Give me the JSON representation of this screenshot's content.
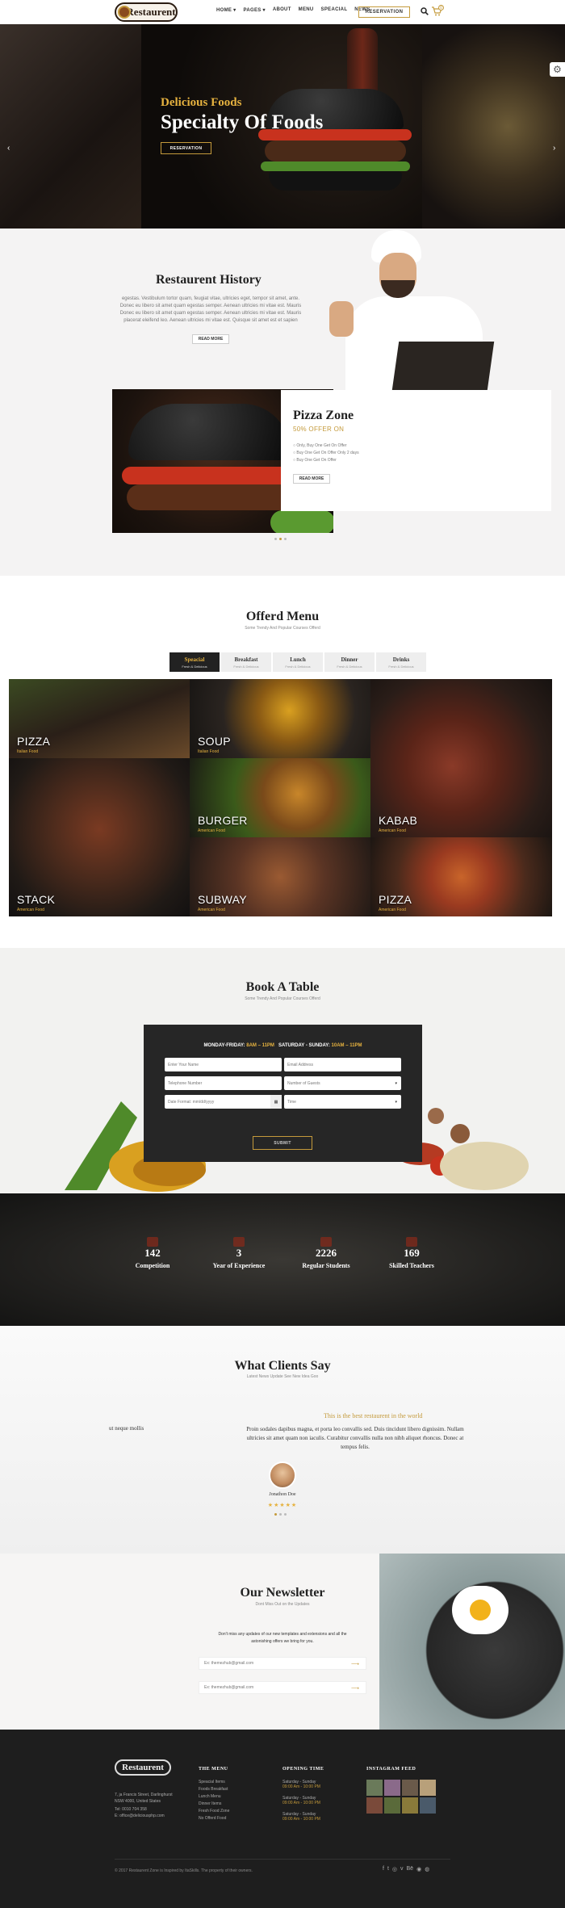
{
  "header": {
    "logo_text": "Restaurent",
    "nav": [
      "HOME ▾",
      "PAGES ▾",
      "ABOUT",
      "MENU",
      "SPEACIAL",
      "NEWS"
    ],
    "reservation_label": "RESERVATION",
    "cart_count": "0"
  },
  "hero": {
    "subtitle": "Delicious Foods",
    "title": "Specialty Of Foods",
    "button_label": "RESERVATION"
  },
  "history": {
    "title": "Restaurent History",
    "text": "egestas. Vestibulum tortor quam, feugiat vitae, ultricies eget, tempor sit amet, ante. Donec eu libero sit amet quam egestas semper. Aenean ultricies mi vitae est. Mauris Donec eu libero sit amet quam egestas semper. Aenean ultricies mi vitae est. Mauris placerat eleifend leo. Aenean ultricies mi vitae est. Quisque sit amet est et sapien ullamcorper pharetra. Vestibulum erat wisi, condimentum sed, commodo vitae, ornare sit amet, wisi. tristique senectus et et malesuada placerat leo.",
    "button_label": "READ MORE",
    "card": {
      "title": "Pizza Zone",
      "offer": "50% OFFER ON",
      "items": [
        "Only, Buy One Get On Offer",
        "Buy One Get On Offer Only 2 days",
        "Buy One Get On Offer"
      ],
      "button_label": "READ MORE"
    }
  },
  "menu": {
    "title": "Offerd Menu",
    "subtitle": "Some Trendy And Popular Courses Offerd",
    "tabs": [
      {
        "label": "Speacial",
        "sub": "Fresh & Delicious"
      },
      {
        "label": "Breakfast",
        "sub": "Fresh & Delicious"
      },
      {
        "label": "Lunch",
        "sub": "Fresh & Delicious"
      },
      {
        "label": "Dinner",
        "sub": "Fresh & Delicious"
      },
      {
        "label": "Drinks",
        "sub": "Fresh & Delicious"
      }
    ],
    "items": [
      {
        "name": "PIZZA",
        "sub": "Italian Food"
      },
      {
        "name": "SOUP",
        "sub": "Italian Food"
      },
      {
        "name": "BURGER",
        "sub": "American Food"
      },
      {
        "name": "KABAB",
        "sub": "American Food"
      },
      {
        "name": "STACK",
        "sub": "American Food"
      },
      {
        "name": "SUBWAY",
        "sub": "American Food"
      },
      {
        "name": "PIZZA",
        "sub": "American Food"
      }
    ]
  },
  "book": {
    "title": "Book A Table",
    "subtitle": "Some Trendy And Popular Courses Offerd",
    "hours_a_label": "MONDAY-FRIDAY:",
    "hours_a_time": "8AM – 11PM",
    "hours_b_label": "SATURDAY - SUNDAY:",
    "hours_b_time": "10AM – 11PM",
    "placeholders": {
      "name": "Enter Your Name",
      "email": "Email Address",
      "phone": "Telephone Number",
      "guests": "Number of Guests",
      "date": "Date Format: mm/dd/yyyy",
      "time": "Time"
    },
    "submit_label": "SUBMIT"
  },
  "counters": [
    {
      "number": "142",
      "label": "Competition"
    },
    {
      "number": "3",
      "label": "Year of Experience"
    },
    {
      "number": "2226",
      "label": "Regular Students"
    },
    {
      "number": "169",
      "label": "Skilled Teachers"
    }
  ],
  "clients": {
    "title": "What Clients Say",
    "subtitle": "Latest News Update See New Idea Goo",
    "quote_title": "This is the best restaurent in the world",
    "left_fragment": "ut neque mollis",
    "text": "Proin sodales dapibus magna, et porta leo convallis sed. Duis tincidunt libero dignissim. Nullam ultricies sit amet quam non iaculis. Curabitur convallis nulla non nibh aliquet rhoncus. Donec at tempus felis.",
    "name": "Jonathon Doe",
    "stars": "★★★★★"
  },
  "newsletter": {
    "title": "Our Newsletter",
    "subtitle": "Dont Miss Out on the Updates",
    "text": "Don't miss any updates of our new templates and extensions and all the astonishing offers we bring for you.",
    "placeholder_1": "Ex: themezhub@gmail.com",
    "placeholder_2": "Ex: themezhub@gmail.com"
  },
  "footer": {
    "logo_text": "Restaurent",
    "address": [
      "7, ja Francis Street, Darlinghurst",
      "NSW 4000, United States",
      "Tel: 0010 704 358",
      "E: office@deliciousphp.com"
    ],
    "menu_head": "THE MENU",
    "menu_links": [
      "Speacial Items",
      "Foods Breakfast",
      "Lunch Menu",
      "Dinner Items",
      "Fresh Food Zone",
      "No Offerd Food"
    ],
    "time_head": "OPENING TIME",
    "times": [
      {
        "day": "Saturday - Sunday",
        "hours": "09:00 Am - 10:00 PM"
      },
      {
        "day": "Saturday - Sunday",
        "hours": "09:00 Am - 10:00 PM"
      },
      {
        "day": "Saturday - Sunday",
        "hours": "09:00 Am - 10:00 PM"
      }
    ],
    "insta_head": "INSTAGRAM FEED",
    "copyright": "© 2017 Restaurent Zone is Inspired by ItaSkills. The property of their owners."
  },
  "colors": {
    "accent": "#c49a3b",
    "gold_text": "#e6b23f",
    "dark": "#1e1e1e"
  }
}
